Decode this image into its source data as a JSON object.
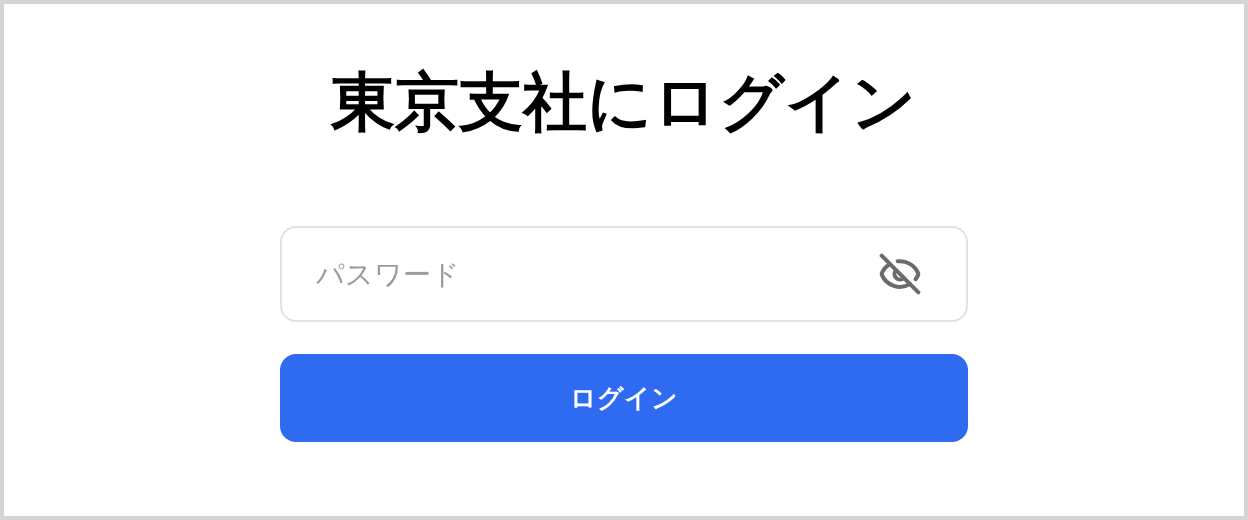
{
  "title": "東京支社にログイン",
  "password_field": {
    "placeholder": "パスワード",
    "show_password": false
  },
  "login_button": {
    "label": "ログイン"
  }
}
